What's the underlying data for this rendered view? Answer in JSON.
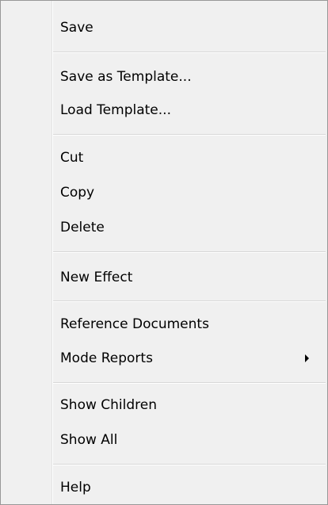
{
  "menu": {
    "items": [
      {
        "label": "Save"
      },
      {
        "label": "Save as Template..."
      },
      {
        "label": "Load Template..."
      },
      {
        "label": "Cut"
      },
      {
        "label": "Copy"
      },
      {
        "label": "Delete"
      },
      {
        "label": "New Effect"
      },
      {
        "label": "Reference Documents"
      },
      {
        "label": "Mode Reports",
        "submenu": true,
        "icon": "chevron-right-icon"
      },
      {
        "label": "Show Children"
      },
      {
        "label": "Show All"
      },
      {
        "label": "Help"
      }
    ]
  },
  "colors": {
    "background": "#f0f0f0",
    "border": "#979797",
    "separator": "#d7d7d7",
    "text": "#000000"
  }
}
